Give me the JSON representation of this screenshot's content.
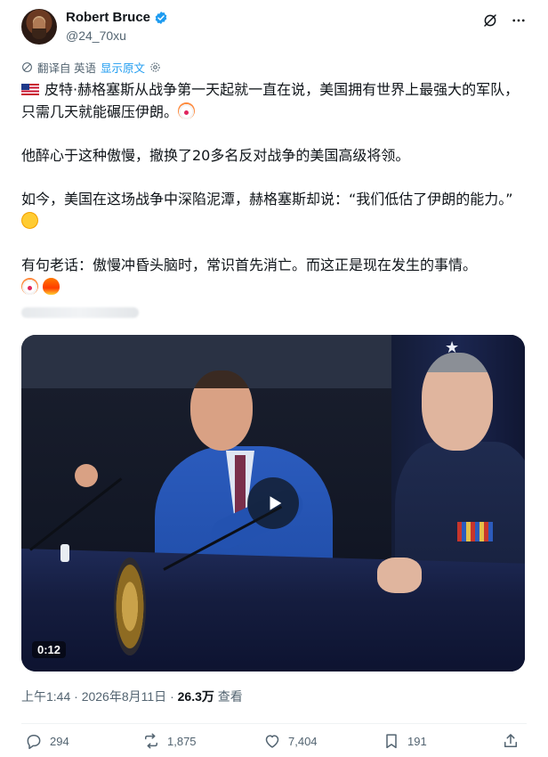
{
  "author": {
    "display_name": "Robert Bruce",
    "handle": "@24_70xu"
  },
  "translation": {
    "label": "翻译自 英语",
    "show_original": "显示原文"
  },
  "tweet": {
    "p1": "皮特·赫格塞斯从战争第一天起就一直在说，美国拥有世界上最强大的军队，只需几天就能碾压伊朗。",
    "p2": "他醉心于这种傲慢，撤换了20多名反对战争的美国高级将领。",
    "p3": "如今，美国在这场战争中深陷泥潭，赫格塞斯却说：“我们低估了伊朗的能力。”",
    "p4": "有句老话：傲慢冲昏头脑时，常识首先消亡。而这正是现在发生的事情。"
  },
  "media": {
    "duration": "0:12"
  },
  "meta": {
    "time": "上午1:44",
    "separator": "·",
    "date": "2026年8月11日",
    "views": "26.3万",
    "views_label": "查看"
  },
  "actions": {
    "replies": "294",
    "reposts": "1,875",
    "likes": "7,404",
    "bookmarks": "191"
  },
  "icons": [
    "verified-badge-icon",
    "grok-icon",
    "more-icon",
    "translate-icon",
    "settings-icon",
    "play-icon",
    "reply-icon",
    "repost-icon",
    "like-icon",
    "bookmark-icon",
    "share-icon"
  ],
  "colors": {
    "accent": "#1d9bf0",
    "secondary_text": "#536471",
    "text": "#0f1419"
  }
}
